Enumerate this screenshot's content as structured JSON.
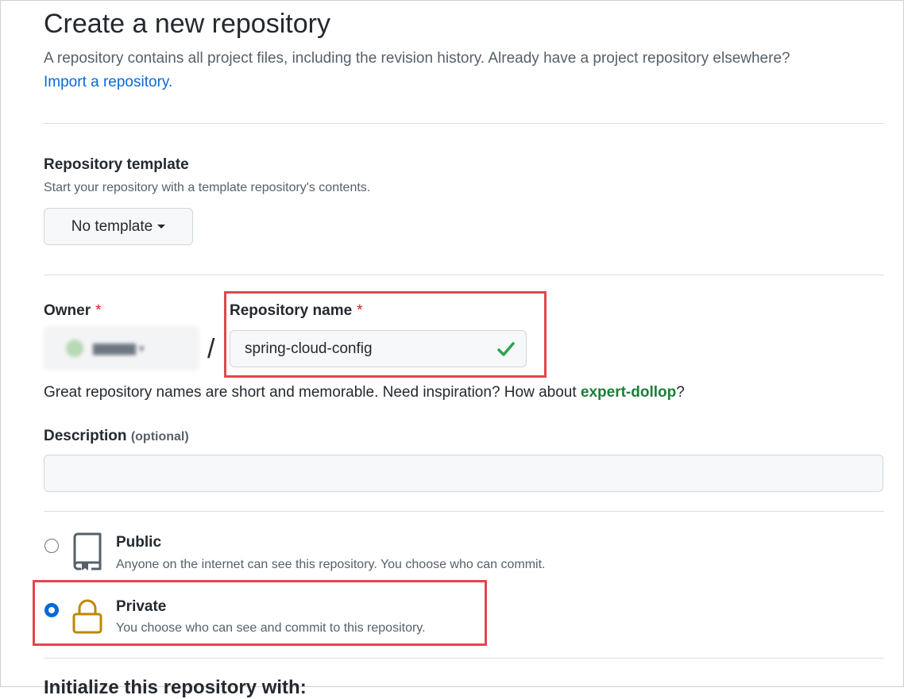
{
  "header": {
    "title": "Create a new repository",
    "subtitle": "A repository contains all project files, including the revision history. Already have a project repository elsewhere?",
    "import_link": "Import a repository."
  },
  "template": {
    "heading": "Repository template",
    "note": "Start your repository with a template repository's contents.",
    "button_label": "No template"
  },
  "owner": {
    "label": "Owner",
    "required_mark": "*"
  },
  "repo": {
    "label": "Repository name",
    "required_mark": "*",
    "value": "spring-cloud-config",
    "separator": "/"
  },
  "hint": {
    "text": "Great repository names are short and memorable. Need inspiration? How about ",
    "suggestion": "expert-dollop",
    "end": "?"
  },
  "description": {
    "label": "Description",
    "optional": "(optional)",
    "value": ""
  },
  "visibility": {
    "public": {
      "label": "Public",
      "note": "Anyone on the internet can see this repository. You choose who can commit.",
      "selected": false
    },
    "private": {
      "label": "Private",
      "note": "You choose who can see and commit to this repository.",
      "selected": true
    }
  },
  "cutoff_heading": "Initialize this repository with:",
  "colors": {
    "link": "#0969da",
    "suggestion": "#1a7f37",
    "highlight": "#e0474c",
    "lock": "#bf8700",
    "check": "#2da44e"
  }
}
